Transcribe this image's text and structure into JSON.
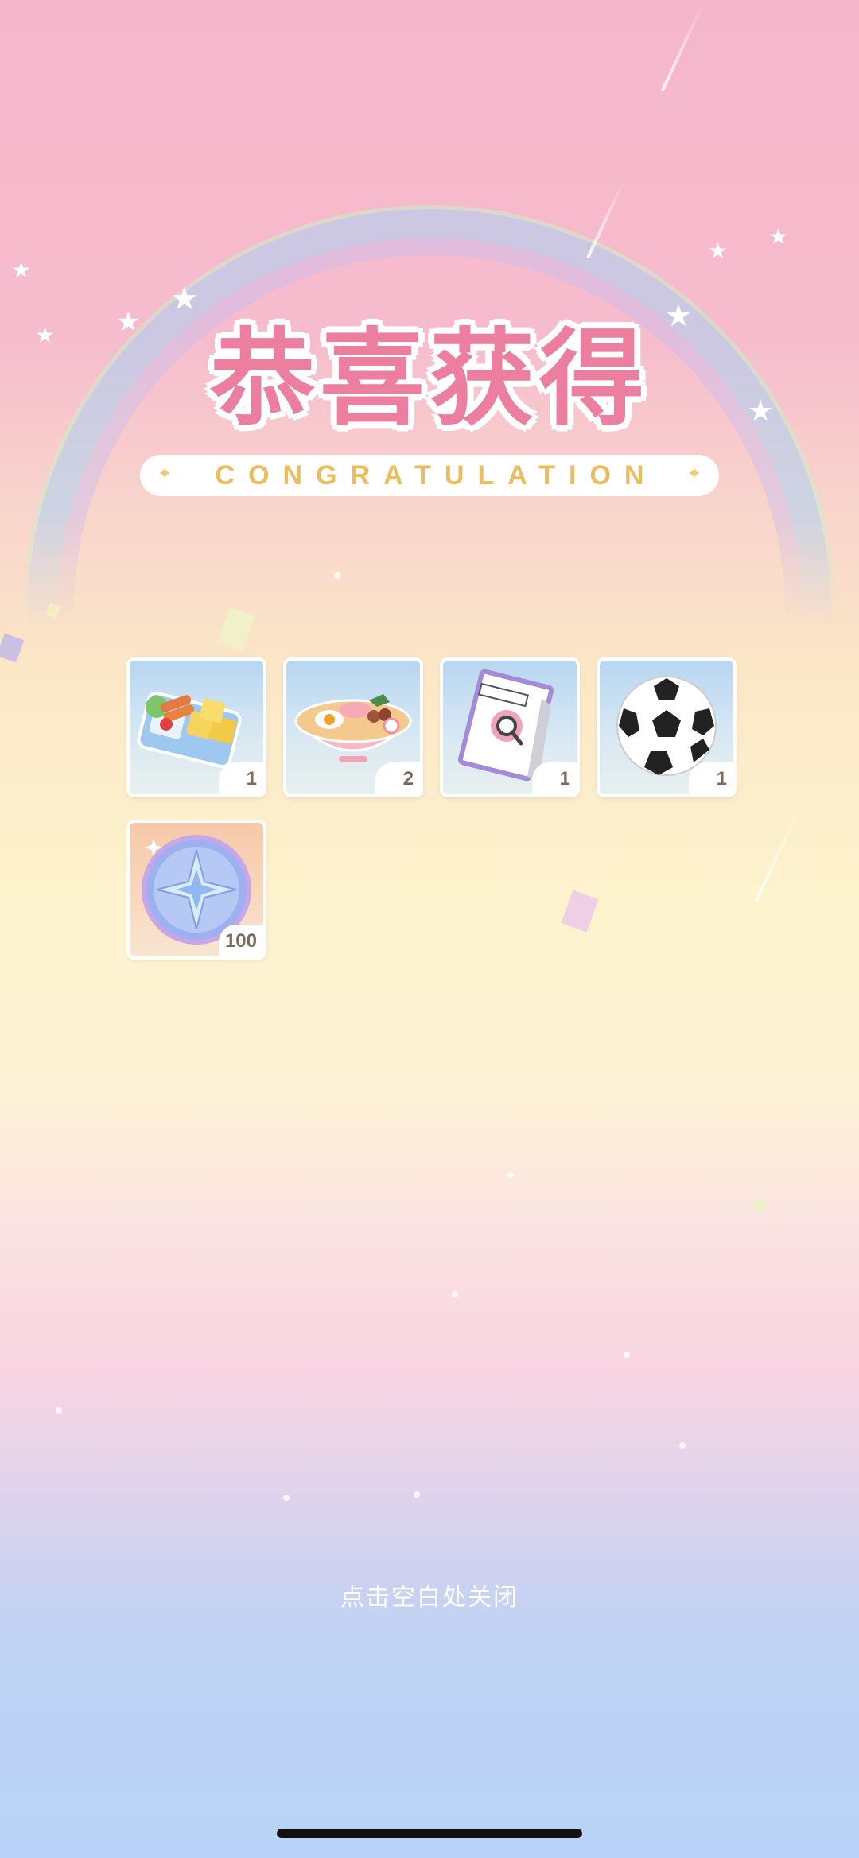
{
  "header": {
    "title": "恭喜获得",
    "subtitle": "CONGRATULATION"
  },
  "rewards": [
    {
      "icon": "bento-box-icon",
      "quantity": "1"
    },
    {
      "icon": "ramen-bowl-icon",
      "quantity": "2"
    },
    {
      "icon": "magazine-icon",
      "quantity": "1"
    },
    {
      "icon": "soccer-ball-icon",
      "quantity": "1"
    },
    {
      "icon": "star-coin-icon",
      "quantity": "100"
    }
  ],
  "footer": {
    "close_hint": "点击空白处关闭"
  },
  "colors": {
    "title": "#ec7fa0",
    "subtitle": "#ebbd5e",
    "quantity_text": "#7c6a5a"
  }
}
